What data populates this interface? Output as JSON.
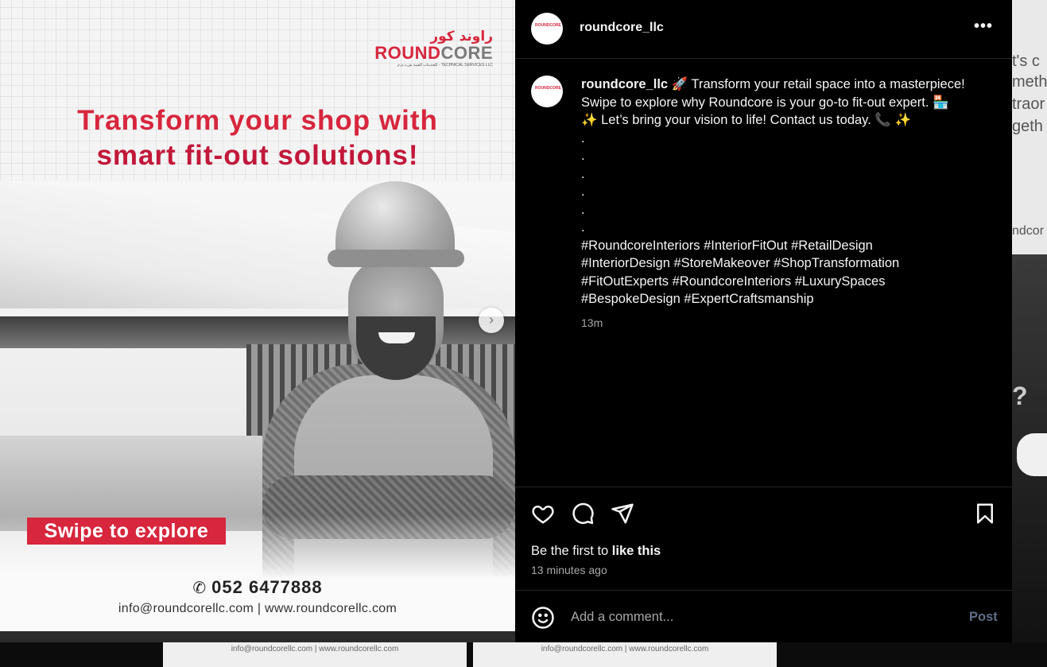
{
  "media": {
    "logo_ar": "راوند كور",
    "logo_en_1": "ROUND",
    "logo_en_2": "CORE",
    "logo_sub": "للخدمات الفنية ش.ذ.م.م - TECHNICAL SERVICES LLC",
    "headline_1": "Transform your shop with",
    "headline_2": "smart fit-out solutions!",
    "swipe_label": "Swipe to explore",
    "phone": "052 6477888",
    "contact": "info@roundcorellc.com | www.roundcorellc.com",
    "next_icon": "chevron-right-icon"
  },
  "header": {
    "username": "roundcore_llc",
    "more_label": "•••",
    "avatar_text": "ROUNDCORE"
  },
  "caption": {
    "username": "roundcore_llc",
    "line_1": "🚀 Transform your retail space into a masterpiece!",
    "line_2": "Swipe to explore why Roundcore is your go-to fit-out expert. 🏪",
    "line_3": "✨ Let’s bring your vision to life! Contact us today. 📞 ✨",
    "dots": [
      ".",
      ".",
      ".",
      ".",
      ".",
      "."
    ],
    "hashtags_1": "#RoundcoreInteriors #InteriorFitOut #RetailDesign",
    "hashtags_2": "#InteriorDesign #StoreMakeover #ShopTransformation",
    "hashtags_3": "#FitOutExperts #RoundcoreInteriors #LuxurySpaces",
    "hashtags_4": "#BespokeDesign #ExpertCraftsmanship",
    "time": "13m"
  },
  "actions": {
    "icons": [
      "heart-icon",
      "comment-icon",
      "share-icon",
      "bookmark-icon"
    ],
    "likes_prefix": "Be the first to ",
    "likes_link": "like this",
    "posted": "13 minutes ago"
  },
  "comment": {
    "placeholder": "Add a comment...",
    "post_label": "Post"
  },
  "background": {
    "peek_1": "t's c",
    "peek_2": "meth",
    "peek_3": "traor",
    "peek_4": "geth",
    "peek_5": "ndcor",
    "peek_qm": "?",
    "bottom_1": "info@roundcorellc.com | www.roundcorellc.com",
    "bottom_2": "info@roundcorellc.com | www.roundcorellc.com"
  }
}
